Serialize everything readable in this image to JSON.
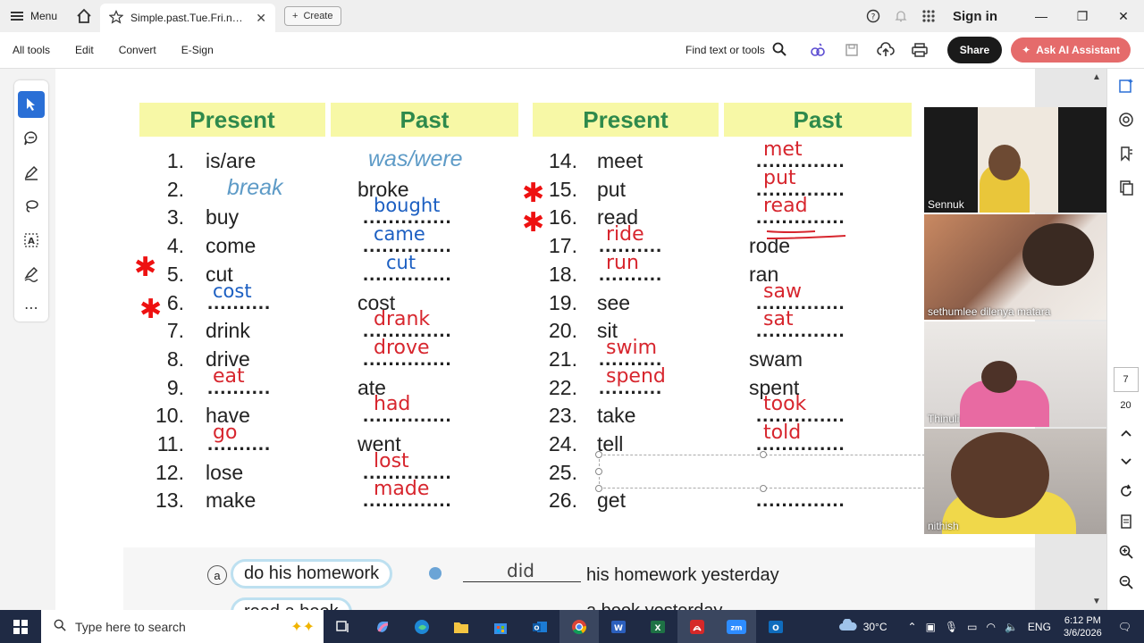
{
  "titlebar": {
    "menu_label": "Menu",
    "tab_title": "Simple.past.Tue.Fri.new (...",
    "create_label": "Create",
    "signin_label": "Sign in"
  },
  "toolbar": {
    "all_tools": "All tools",
    "edit": "Edit",
    "convert": "Convert",
    "esign": "E-Sign",
    "find": "Find text or tools",
    "share": "Share",
    "ai_assistant": "Ask AI Assistant"
  },
  "worksheet": {
    "headers": [
      "Present",
      "Past",
      "Present",
      "Past"
    ],
    "left_rows": [
      {
        "n": "1.",
        "present": "is/are",
        "past": "was/were"
      },
      {
        "n": "2.",
        "present": "break",
        "past": "broke"
      },
      {
        "n": "3.",
        "present": "buy",
        "past": "bought"
      },
      {
        "n": "4.",
        "present": "come",
        "past": "came"
      },
      {
        "n": "5.",
        "present": "cut",
        "past": "cut"
      },
      {
        "n": "6.",
        "present": "cost",
        "past": "cost"
      },
      {
        "n": "7.",
        "present": "drink",
        "past": "drank"
      },
      {
        "n": "8.",
        "present": "drive",
        "past": "drove"
      },
      {
        "n": "9.",
        "present": "eat",
        "past": "ate"
      },
      {
        "n": "10.",
        "present": "have",
        "past": "had"
      },
      {
        "n": "11.",
        "present": "go",
        "past": "went"
      },
      {
        "n": "12.",
        "present": "lose",
        "past": "lost"
      },
      {
        "n": "13.",
        "present": "make",
        "past": "made"
      }
    ],
    "right_rows": [
      {
        "n": "14.",
        "present": "meet",
        "past": "met"
      },
      {
        "n": "15.",
        "present": "put",
        "past": "put"
      },
      {
        "n": "16.",
        "present": "read",
        "past": "read"
      },
      {
        "n": "17.",
        "present": "ride",
        "past": "rode"
      },
      {
        "n": "18.",
        "present": "run",
        "past": "ran"
      },
      {
        "n": "19.",
        "present": "see",
        "past": "saw"
      },
      {
        "n": "20.",
        "present": "sit",
        "past": "sat"
      },
      {
        "n": "21.",
        "present": "swim",
        "past": "swam"
      },
      {
        "n": "22.",
        "present": "spend",
        "past": "spent"
      },
      {
        "n": "23.",
        "present": "take",
        "past": "took"
      },
      {
        "n": "24.",
        "present": "tell",
        "past": "told"
      },
      {
        "n": "25.",
        "present": "",
        "past": ""
      },
      {
        "n": "26.",
        "present": "get",
        "past": ""
      }
    ],
    "dots_long": "..............",
    "dots_mid": "..........",
    "dots_short": "........",
    "lower": {
      "bullet_a": "a",
      "phrase_a": "do his homework",
      "answer_a": "did",
      "rest_a": "his homework yesterday",
      "phrase_b": "read a book",
      "rest_b": "a book yesterday"
    }
  },
  "participants": [
    "Sennuk",
    "sethumlee dilenya matara",
    "Thinuli",
    "nithish"
  ],
  "navigation": {
    "current_page": "7",
    "total_pages": "20"
  },
  "taskbar": {
    "search_placeholder": "Type here to search",
    "temperature": "30°C",
    "language": "ENG",
    "time": "6:12 PM",
    "date": "3/6/2026"
  },
  "colors": {
    "header_bg": "#f7f8a6",
    "header_text": "#2f8a4c",
    "ink_red": "#d7262e",
    "ink_blue": "#1c5fc2",
    "accent_ai": "#e56b6b"
  }
}
